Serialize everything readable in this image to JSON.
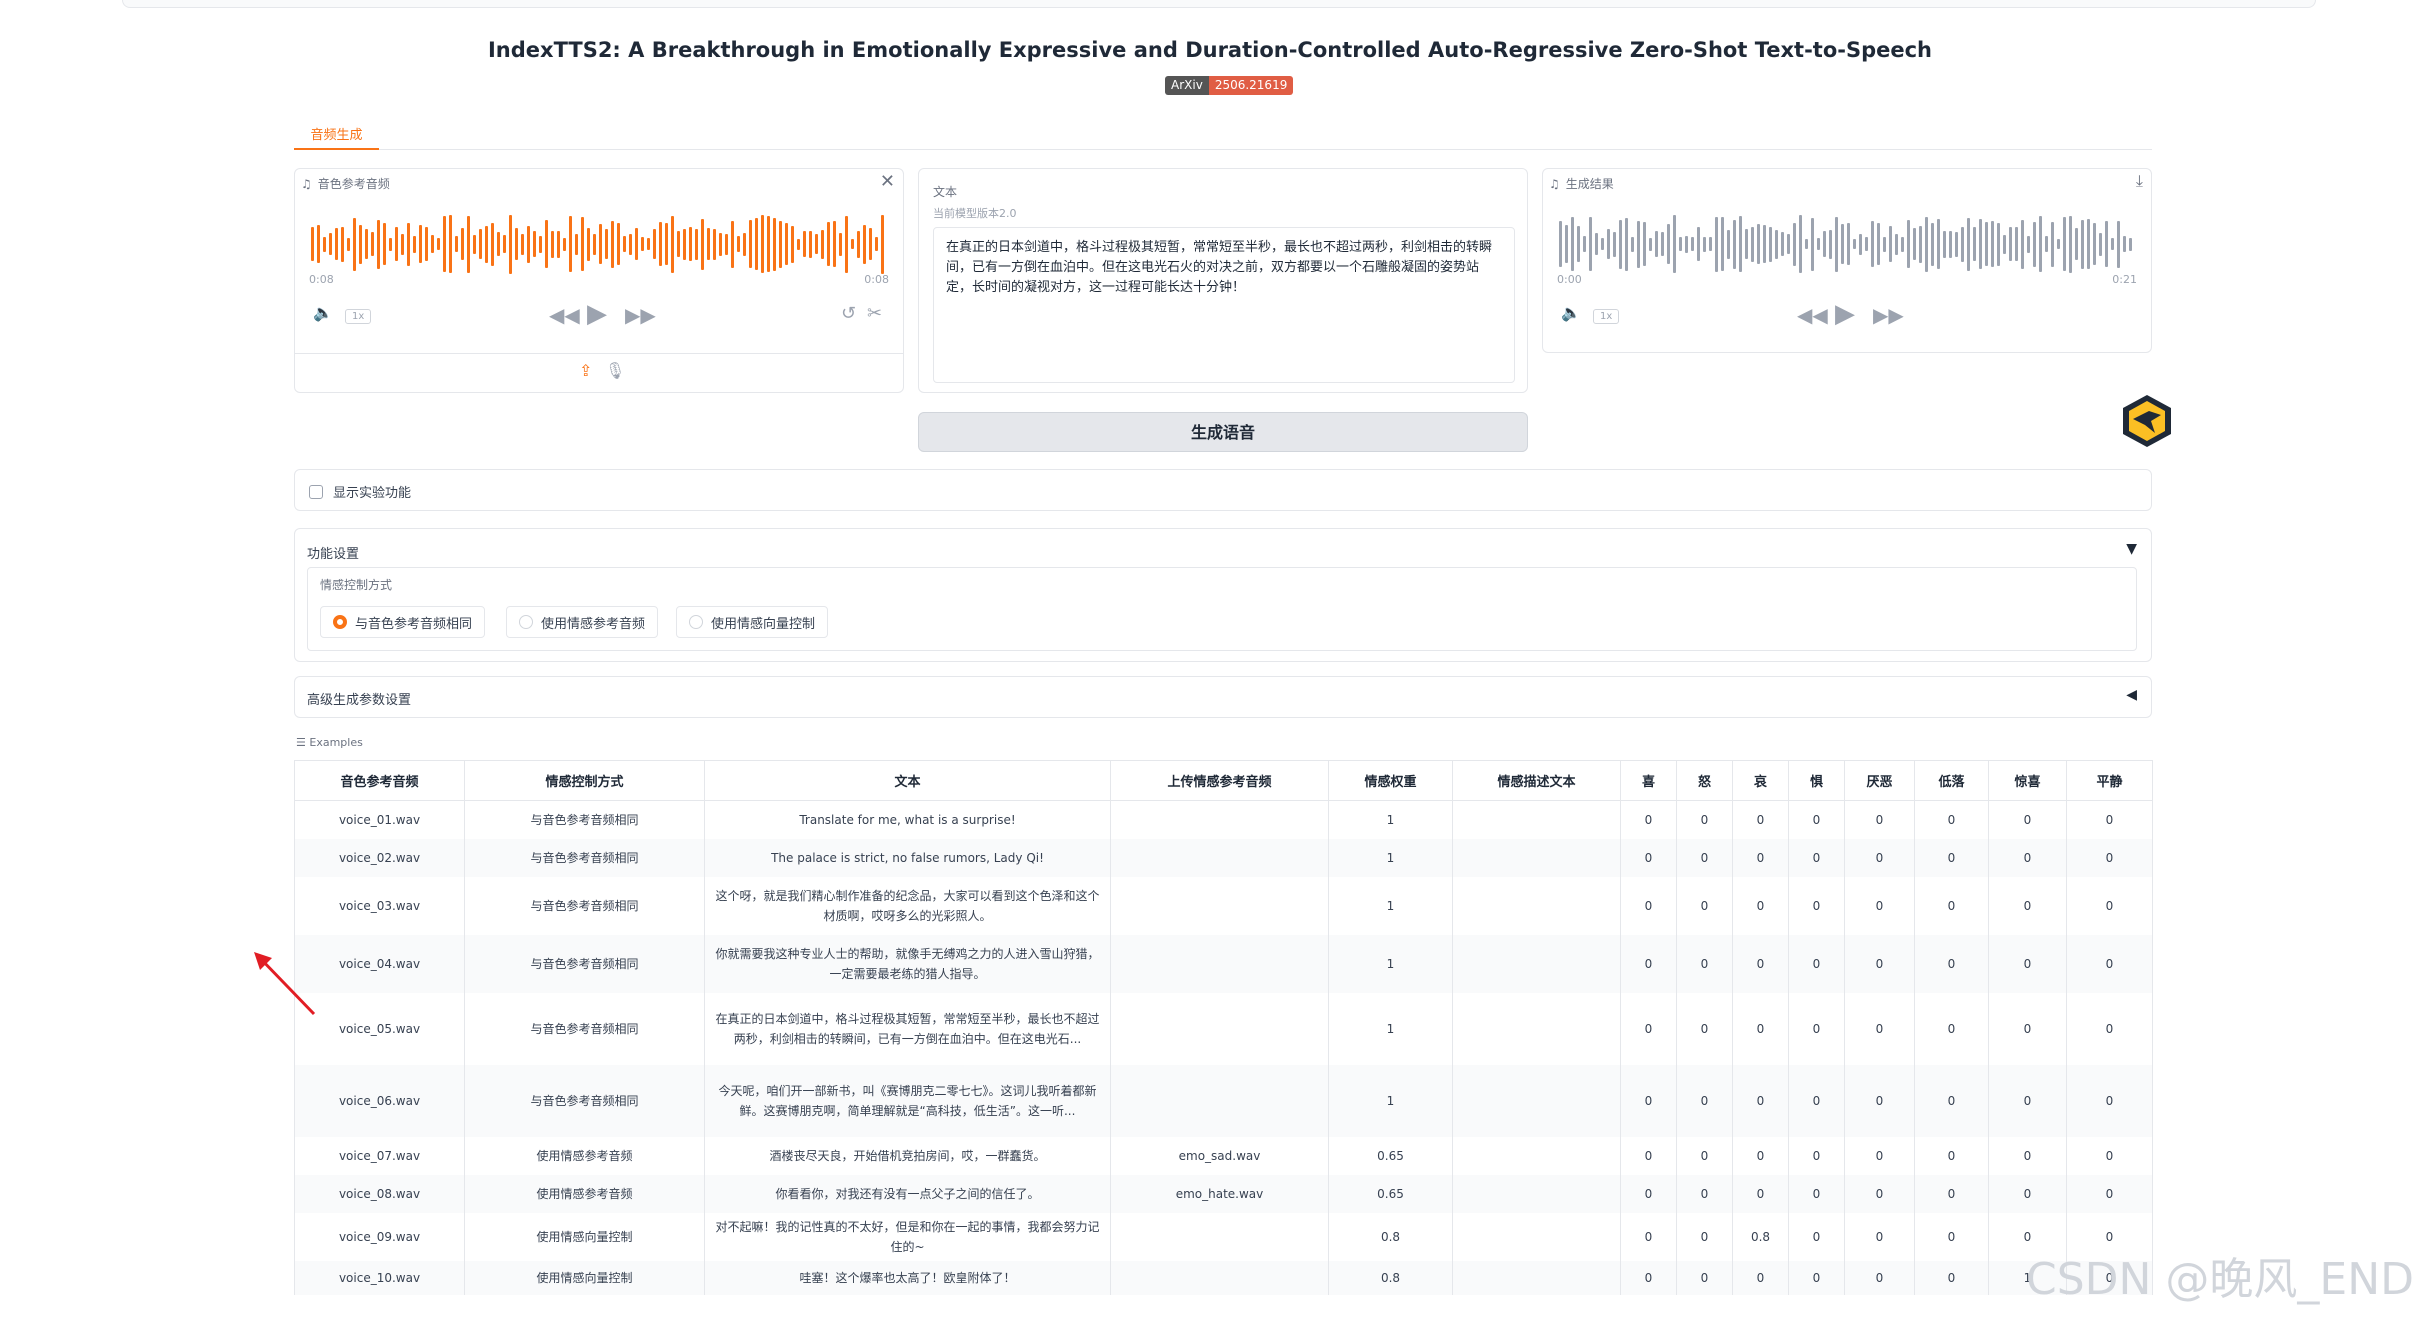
{
  "title": "IndexTTS2: A Breakthrough in Emotionally Expressive and Duration-Controlled Auto-Regressive Zero-Shot Text-to-Speech",
  "badge": {
    "left": "ArXiv",
    "right": "2506.21619"
  },
  "tab_label": "音频生成",
  "ref_audio": {
    "label": "音色参考音频",
    "time_start": "0:08",
    "time_end": "0:08",
    "speed": "1x"
  },
  "text_panel": {
    "label": "文本",
    "note": "当前模型版本2.0",
    "content": "在真正的日本剑道中，格斗过程极其短暂，常常短至半秒，最长也不超过两秒，利剑相击的转瞬间，已有一方倒在血泊中。但在这电光石火的对决之前，双方都要以一个石雕般凝固的姿势站定，长时间的凝视对方，这一过程可能长达十分钟！"
  },
  "result_audio": {
    "label": "生成结果",
    "time_start": "0:00",
    "time_end": "0:21",
    "speed": "1x"
  },
  "generate_label": "生成语音",
  "experimental_label": "显示实验功能",
  "settings": {
    "label": "功能设置",
    "emotion_label": "情感控制方式",
    "options": [
      "与音色参考音频相同",
      "使用情感参考音频",
      "使用情感向量控制"
    ]
  },
  "advanced_label": "高级生成参数设置",
  "examples_label": "Examples",
  "colors": {
    "accent": "#f97316",
    "wave_ref": "#f97316",
    "wave_result": "#9ca3af"
  },
  "table": {
    "headers": [
      "音色参考音频",
      "情感控制方式",
      "文本",
      "上传情感参考音频",
      "情感权重",
      "情感描述文本",
      "喜",
      "怒",
      "哀",
      "惧",
      "厌恶",
      "低落",
      "惊喜",
      "平静"
    ],
    "rows": [
      [
        "voice_01.wav",
        "与音色参考音频相同",
        "Translate for me, what is a surprise!",
        "",
        "1",
        "",
        "0",
        "0",
        "0",
        "0",
        "0",
        "0",
        "0",
        "0"
      ],
      [
        "voice_02.wav",
        "与音色参考音频相同",
        "The palace is strict, no false rumors, Lady Qi!",
        "",
        "1",
        "",
        "0",
        "0",
        "0",
        "0",
        "0",
        "0",
        "0",
        "0"
      ],
      [
        "voice_03.wav",
        "与音色参考音频相同",
        "这个呀，就是我们精心制作准备的纪念品，大家可以看到这个色泽和这个材质啊，哎呀多么的光彩照人。",
        "",
        "1",
        "",
        "0",
        "0",
        "0",
        "0",
        "0",
        "0",
        "0",
        "0"
      ],
      [
        "voice_04.wav",
        "与音色参考音频相同",
        "你就需要我这种专业人士的帮助，就像手无缚鸡之力的人进入雪山狩猎，一定需要最老练的猎人指导。",
        "",
        "1",
        "",
        "0",
        "0",
        "0",
        "0",
        "0",
        "0",
        "0",
        "0"
      ],
      [
        "voice_05.wav",
        "与音色参考音频相同",
        "在真正的日本剑道中，格斗过程极其短暂，常常短至半秒，最长也不超过两秒，利剑相击的转瞬间，已有一方倒在血泊中。但在这电光石...",
        "",
        "1",
        "",
        "0",
        "0",
        "0",
        "0",
        "0",
        "0",
        "0",
        "0"
      ],
      [
        "voice_06.wav",
        "与音色参考音频相同",
        "今天呢，咱们开一部新书，叫《赛博朋克二零七七》。这词儿我听着都新鲜。这赛博朋克啊，简单理解就是“高科技，低生活”。这一听...",
        "",
        "1",
        "",
        "0",
        "0",
        "0",
        "0",
        "0",
        "0",
        "0",
        "0"
      ],
      [
        "voice_07.wav",
        "使用情感参考音频",
        "酒楼丧尽天良，开始借机竞拍房间，哎，一群蠢货。",
        "emo_sad.wav",
        "0.65",
        "",
        "0",
        "0",
        "0",
        "0",
        "0",
        "0",
        "0",
        "0"
      ],
      [
        "voice_08.wav",
        "使用情感参考音频",
        "你看看你，对我还有没有一点父子之间的信任了。",
        "emo_hate.wav",
        "0.65",
        "",
        "0",
        "0",
        "0",
        "0",
        "0",
        "0",
        "0",
        "0"
      ],
      [
        "voice_09.wav",
        "使用情感向量控制",
        "对不起嘛！我的记性真的不太好，但是和你在一起的事情，我都会努力记住的~",
        "",
        "0.8",
        "",
        "0",
        "0",
        "0.8",
        "0",
        "0",
        "0",
        "0",
        "0"
      ],
      [
        "voice_10.wav",
        "使用情感向量控制",
        "哇塞！这个爆率也太高了！欧皇附体了！",
        "",
        "0.8",
        "",
        "0",
        "0",
        "0",
        "0",
        "0",
        "0",
        "1",
        "0"
      ]
    ]
  },
  "watermark": "CSDN @晚风_END"
}
